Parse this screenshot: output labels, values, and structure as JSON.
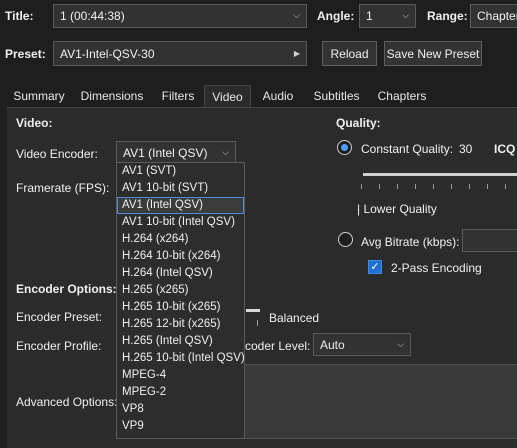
{
  "source": {
    "title_label": "Title:",
    "title_value": "1  (00:44:38)",
    "angle_label": "Angle:",
    "angle_value": "1",
    "range_label": "Range:",
    "range_value": "Chapters"
  },
  "preset": {
    "label": "Preset:",
    "value": "AV1-Intel-QSV-30",
    "reload_label": "Reload",
    "save_new_label": "Save New Preset"
  },
  "tabs": [
    "Summary",
    "Dimensions",
    "Filters",
    "Video",
    "Audio",
    "Subtitles",
    "Chapters"
  ],
  "active_tab": "Video",
  "video": {
    "section_label": "Video:",
    "encoder_label": "Video Encoder:",
    "encoder_value": "AV1 (Intel QSV)",
    "framerate_label": "Framerate (FPS):",
    "encoder_options_label": "Encoder Options:",
    "encoder_preset_label": "Encoder Preset:",
    "encoder_preset_value": "Balanced",
    "encoder_profile_label": "Encoder Profile:",
    "encoder_level_label": "coder Level:",
    "encoder_level_value": "Auto",
    "advanced_options_label": "Advanced Options:"
  },
  "encoder_options": [
    "AV1 (SVT)",
    "AV1 10-bit (SVT)",
    "AV1 (Intel QSV)",
    "AV1 10-bit (Intel QSV)",
    "H.264 (x264)",
    "H.264 10-bit (x264)",
    "H.264 (Intel QSV)",
    "H.265 (x265)",
    "H.265 10-bit (x265)",
    "H.265 12-bit (x265)",
    "H.265 (Intel QSV)",
    "H.265 10-bit (Intel QSV)",
    "MPEG-4",
    "MPEG-2",
    "VP8",
    "VP9"
  ],
  "encoder_selected_index": 2,
  "quality": {
    "section_label": "Quality:",
    "constant_quality_label": "Constant Quality:",
    "constant_quality_value": "30",
    "constant_quality_unit": "ICQ",
    "lower_quality_label": "| Lower Quality",
    "avg_bitrate_label": "Avg Bitrate (kbps):",
    "two_pass_label": "2-Pass Encoding",
    "mode": "constant_quality",
    "two_pass_checked": true
  },
  "colors": {
    "accent": "#4a9fff",
    "background": "#1e1e1e",
    "panel": "#2b2b2b"
  }
}
